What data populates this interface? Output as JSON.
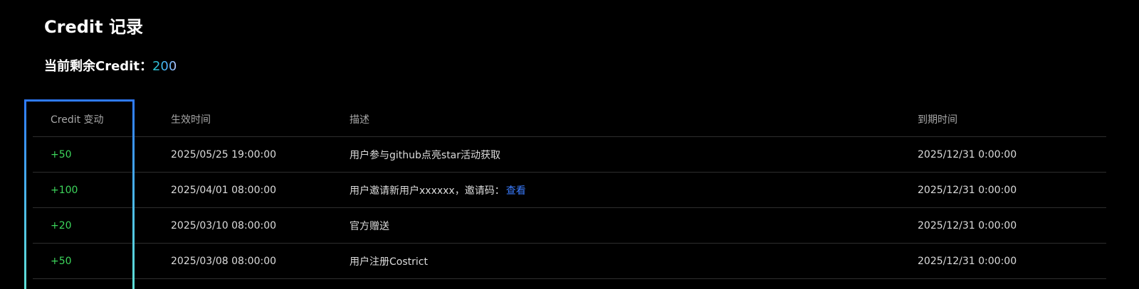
{
  "page": {
    "title": "Credit 记录",
    "balance_label": "当前剩余Credit：",
    "balance_value": "200"
  },
  "table": {
    "headers": {
      "change": "Credit 变动",
      "effective_time": "生效时间",
      "description": "描述",
      "expire_time": "到期时间"
    },
    "rows": [
      {
        "change": "+50",
        "effective_time": "2025/05/25 19:00:00",
        "description": "用户参与github点亮star活动获取",
        "link": "",
        "expire_time": "2025/12/31 0:00:00"
      },
      {
        "change": "+100",
        "effective_time": "2025/04/01 08:00:00",
        "description": "用户邀请新用户xxxxxx，邀请码：",
        "link": "查看",
        "expire_time": "2025/12/31 0:00:00"
      },
      {
        "change": "+20",
        "effective_time": "2025/03/10 08:00:00",
        "description": "官方赠送",
        "link": "",
        "expire_time": "2025/12/31 0:00:00"
      },
      {
        "change": "+50",
        "effective_time": "2025/03/08 08:00:00",
        "description": "用户注册Costrict",
        "link": "",
        "expire_time": "2025/12/31 0:00:00"
      }
    ]
  },
  "colors": {
    "background": "#000000",
    "positive_change": "#3dd65c",
    "link": "#3a7cff",
    "highlight_border": "#2f7bff"
  }
}
